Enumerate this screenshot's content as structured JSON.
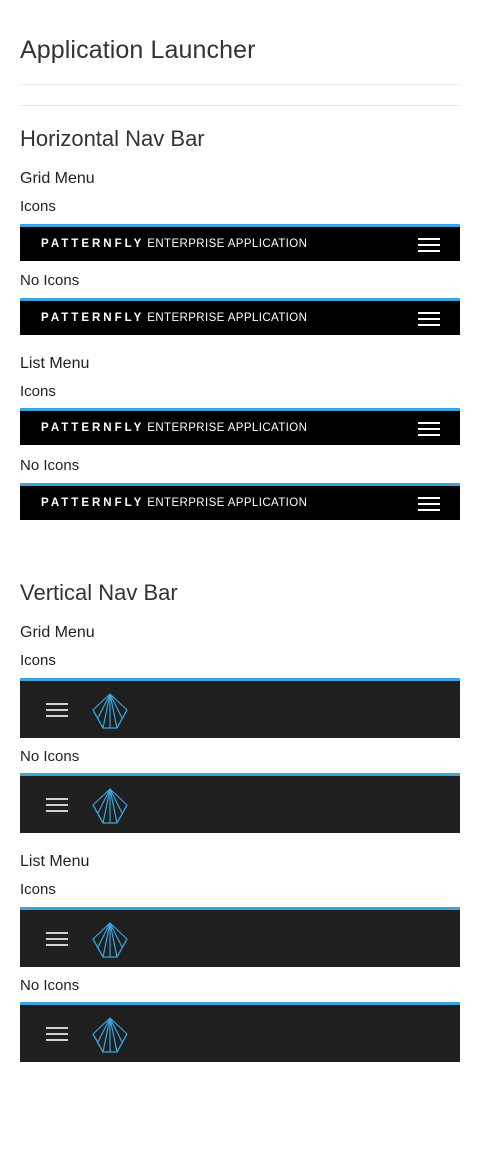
{
  "page": {
    "title": "Application Launcher"
  },
  "horizontal": {
    "title": "Horizontal Nav Bar",
    "grid_label": "Grid Menu",
    "list_label": "List Menu",
    "icons_label": "Icons",
    "no_icons_label": "No Icons"
  },
  "vertical": {
    "title": "Vertical Nav Bar",
    "grid_label": "Grid Menu",
    "list_label": "List Menu",
    "icons_label": "Icons",
    "no_icons_label": "No Icons"
  },
  "brand": {
    "name": "PATTERNFLY",
    "tagline": "ENTERPRISE APPLICATION"
  },
  "icons": {
    "menu": "hamburger-menu-icon",
    "logo": "patternfly-logo-icon"
  },
  "colors": {
    "accent": "#39a5dc",
    "horizontal_bar": "#000000",
    "vertical_bar": "#1f1f1f"
  }
}
